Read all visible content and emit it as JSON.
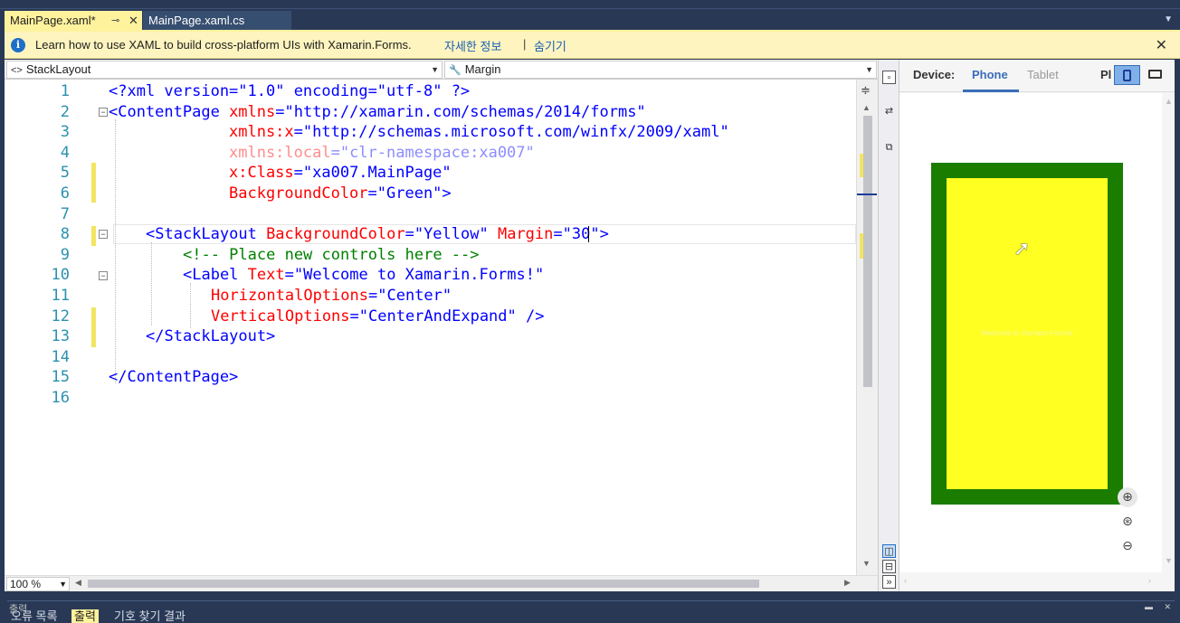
{
  "tabs": [
    {
      "label": "MainPage.xaml*",
      "active": true,
      "pin": "⊸",
      "close": "✕"
    },
    {
      "label": "MainPage.xaml.cs",
      "active": false
    }
  ],
  "tab_overflow_icon": "chevron-down-icon",
  "infobar": {
    "icon": "i",
    "message": "Learn how to use XAML to build cross-platform UIs with Xamarin.Forms.",
    "link_more": "자세한 정보",
    "separator": "|",
    "link_hide": "숨기기",
    "close": "✕"
  },
  "navbar": {
    "left_icon": "<>",
    "left_value": "StackLayout",
    "right_icon": "🔧",
    "right_value": "Margin"
  },
  "editor": {
    "line_numbers": [
      "1",
      "2",
      "3",
      "4",
      "5",
      "6",
      "7",
      "8",
      "9",
      "10",
      "11",
      "12",
      "13",
      "14",
      "15",
      "16"
    ],
    "lines": {
      "l1": "<?xml version=\"1.0\" encoding=\"utf-8\" ?>",
      "l2_tag": "<ContentPage",
      "l2_attr": " xmlns",
      "l2_eq": "=",
      "l2_val": "\"http://xamarin.com/schemas/2014/forms\"",
      "l3_attr": "xmlns:x",
      "l3_val": "=\"http://schemas.microsoft.com/winfx/2009/xaml\"",
      "l4_attr": "xmlns:local",
      "l4_val": "=\"clr-namespace:xa007\"",
      "l5_attr": "x:Class",
      "l5_val": "=\"xa007.MainPage\"",
      "l6_attr": "BackgroundColor",
      "l6_val": "=\"Green\"",
      "l6_close": ">",
      "l8_tag": "<StackLayout",
      "l8_attr1": " BackgroundColor",
      "l8_val1": "=\"Yellow\"",
      "l8_attr2": " Margin",
      "l8_val2": "=\"30\"",
      "l8_close": ">",
      "l9": "<!-- Place new controls here -->",
      "l10_tag": "<Label",
      "l10_attr": " Text",
      "l10_val": "=\"Welcome to Xamarin.Forms!\"",
      "l11_attr": "HorizontalOptions",
      "l11_val": "=\"Center\"",
      "l12_attr": "VerticalOptions",
      "l12_val": "=\"CenterAndExpand\"",
      "l12_close": " />",
      "l13": "</StackLayout>",
      "l15": "</ContentPage>"
    }
  },
  "zoom": {
    "value": "100 %"
  },
  "designer": {
    "device_label": "Device:",
    "device_phone": "Phone",
    "device_tablet": "Tablet",
    "platform_label": "Pl",
    "page_background": "#1a7d00",
    "stack_background": "#ffff22",
    "label_text": "Welcome to Xamarin.Forms!",
    "zoom_in": "⊕",
    "zoom_fit": "⊛",
    "zoom_out": "⊖"
  },
  "vtools": {
    "split_vertical": "⇄",
    "swap": "⇵"
  },
  "bottom_panel": {
    "title": "출력",
    "tabs": [
      "오류 목록",
      "출력",
      "기호 찾기 결과"
    ],
    "active_tab": "출력"
  },
  "colors": {
    "vs_frame": "#293955",
    "active_tab": "#fff29d",
    "infobar": "#fdf4bf",
    "keyword": "#a31515",
    "attribute": "#ff0000",
    "value": "#0000ff",
    "comment": "#008000",
    "line_number": "#2b91af"
  }
}
